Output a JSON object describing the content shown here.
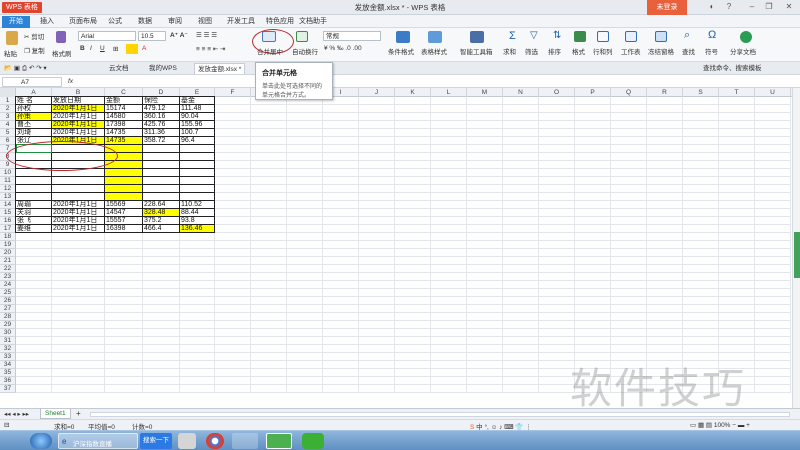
{
  "window": {
    "app_badge": "WPS 表格",
    "title": "发放金额.xlsx * - WPS 表格",
    "login_label": "未登录"
  },
  "menu": {
    "items": [
      "开始",
      "插入",
      "页面布局",
      "公式",
      "数据",
      "审阅",
      "视图",
      "开发工具",
      "特色应用",
      "文档助手"
    ],
    "active": "开始"
  },
  "ribbon": {
    "paste": "粘贴",
    "cut": "剪切",
    "copy": "复制",
    "format_painter": "格式刷",
    "font_name": "Arial",
    "font_size": "10.5",
    "merge_center": "合并居中",
    "wrap_text": "自动换行",
    "number_format": "常规",
    "cond_format": "条件格式",
    "table_style": "表格样式",
    "smart_toolbox": "智能工具箱",
    "sum": "求和",
    "filter": "筛选",
    "sort": "排序",
    "format": "格式",
    "row_col": "行和列",
    "worksheet": "工作表",
    "freeze": "冻结窗格",
    "find": "查找",
    "symbol": "符号",
    "share": "分享文档"
  },
  "tabs": {
    "items": [
      "云文档",
      "我的WPS",
      "发放金额.xlsx *"
    ],
    "search_placeholder": "查找命令、搜索模板"
  },
  "formula_bar": {
    "name_box": "A7",
    "fx": "fx"
  },
  "tooltip": {
    "title": "合并单元格",
    "body_line1": "单击此处可选择不同的",
    "body_line2": "单元格合并方式。"
  },
  "grid": {
    "columns": [
      "A",
      "B",
      "C",
      "D",
      "E",
      "F",
      "G",
      "H",
      "I",
      "J",
      "K",
      "L",
      "M",
      "N",
      "O",
      "P",
      "Q",
      "R",
      "S",
      "T",
      "U"
    ],
    "rows": [
      "1",
      "2",
      "3",
      "4",
      "5",
      "6",
      "7",
      "8",
      "9",
      "10",
      "11",
      "12",
      "13",
      "14",
      "15",
      "16",
      "17",
      "18",
      "19",
      "20",
      "21",
      "22",
      "23",
      "24",
      "25",
      "26",
      "27",
      "28",
      "29",
      "30",
      "31",
      "32",
      "33",
      "34",
      "35",
      "36",
      "37"
    ],
    "header": [
      "姓 名",
      "发放日期",
      "金额",
      "保险",
      "基金"
    ],
    "data": [
      [
        "孙权",
        "2020年1月1日",
        "15174",
        "479.12",
        "111.48"
      ],
      [
        "孙策",
        "2020年1月1日",
        "14580",
        "360.16",
        "90.04"
      ],
      [
        "曹丕",
        "2020年1月1日",
        "17398",
        "425.76",
        "155.96"
      ],
      [
        "刘琦",
        "2020年1月1日",
        "14735",
        "311.36",
        "100.7"
      ],
      [
        "张辽",
        "2020年1月1日",
        "14735",
        "358.72",
        "96.4"
      ]
    ],
    "data2": [
      [
        "周瑜",
        "2020年1月1日",
        "15569",
        "228.64",
        "110.52"
      ],
      [
        "关羽",
        "2020年1月1日",
        "14547",
        "328.48",
        "88.44"
      ],
      [
        "张飞",
        "2020年1月1日",
        "15557",
        "375.2",
        "93.8"
      ],
      [
        "姜维",
        "2020年1月1日",
        "16398",
        "466.4",
        "136.46"
      ]
    ],
    "highlight_color": "#ffff00",
    "annotation_color": "#c0282e"
  },
  "sheets": {
    "tabs": [
      "Sheet1"
    ],
    "add": "+"
  },
  "status": {
    "sum": "求和=0",
    "avg": "平均值=0",
    "count": "计数=0"
  },
  "taskbar": {
    "ie_label": "沪深指数直播",
    "search_button": "搜索一下"
  },
  "watermark": "软件技巧"
}
